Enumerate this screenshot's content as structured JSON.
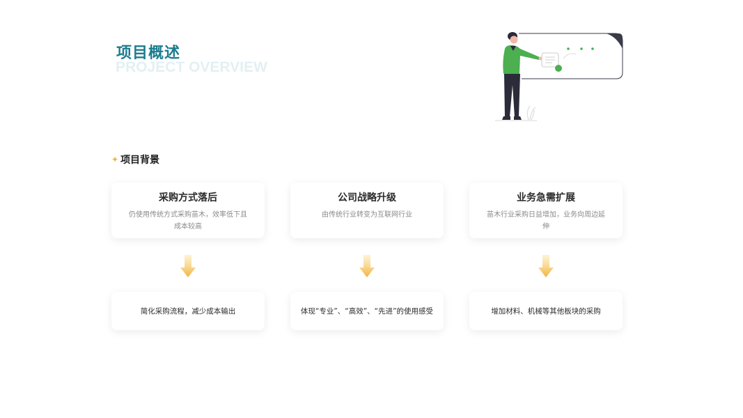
{
  "header": {
    "title_cn": "项目概述",
    "title_en": "PROJECT OVERVIEW"
  },
  "section": {
    "star": "✦",
    "label": "项目背景"
  },
  "top_cards": [
    {
      "title": "采购方式落后",
      "desc": "仍使用传统方式采购苗木，效率低下且成本较高"
    },
    {
      "title": "公司战略升级",
      "desc": "由传统行业转变为互联网行业"
    },
    {
      "title": "业务急需扩展",
      "desc": "苗木行业采购日益增加，业务向周边延伸"
    }
  ],
  "bottom_cards": [
    {
      "text": "简化采购流程，减少成本输出"
    },
    {
      "text": "体现“专业”、“高效”、“先进”的使用感受"
    },
    {
      "text": "增加材料、机械等其他板块的采购"
    }
  ],
  "colors": {
    "title_accent": "#1c7c8f",
    "title_ghost": "#e3f0f3",
    "arrow": "#f0b23a",
    "figure_shirt": "#4caf50"
  }
}
